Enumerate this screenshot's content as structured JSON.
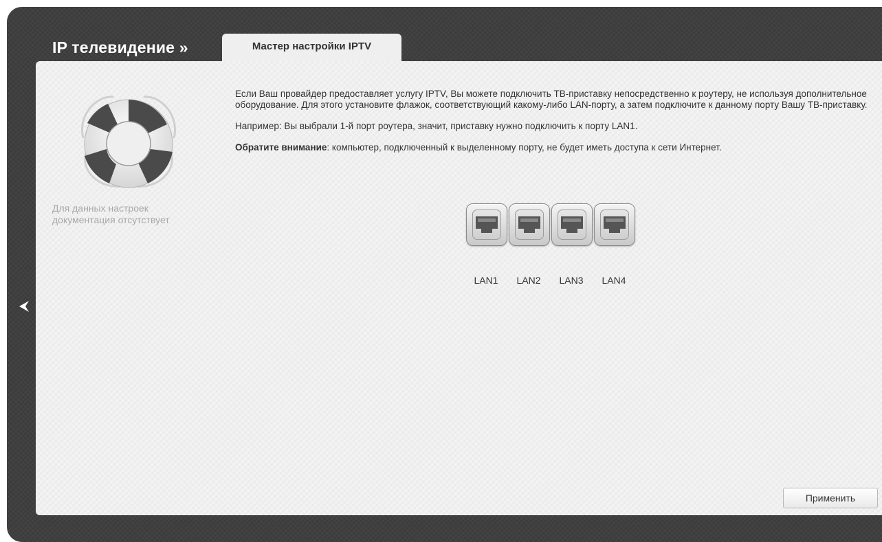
{
  "header": {
    "section_title": "IP телевидение »",
    "tab_label": "Мастер настройки IPTV"
  },
  "sidebar": {
    "help_icon": "lifebuoy-icon",
    "help_text": "Для данных настроек документация отсутствует"
  },
  "nav": {
    "back_icon": "chevron-left-icon"
  },
  "main": {
    "intro": "Если Ваш провайдер предоставляет услугу IPTV, Вы можете подключить ТВ-приставку непосредственно к роутеру, не используя дополнительное оборудование. Для этого установите флажок, соответствующий какому-либо LAN-порту, а затем подключите к данному порту Вашу ТВ-приставку.",
    "example": "Например: Вы выбрали 1-й порт роутера, значит, приставку нужно подключить к порту LAN1.",
    "note_label": "Обратите внимание",
    "note_text": ": компьютер, подключенный к выделенному порту, не будет иметь доступа к сети Интернет.",
    "ports": [
      {
        "label": "LAN1",
        "icon": "ethernet-port-icon"
      },
      {
        "label": "LAN2",
        "icon": "ethernet-port-icon"
      },
      {
        "label": "LAN3",
        "icon": "ethernet-port-icon"
      },
      {
        "label": "LAN4",
        "icon": "ethernet-port-icon"
      }
    ]
  },
  "footer": {
    "apply_label": "Применить"
  },
  "colors": {
    "frame": "#3f3f3f",
    "panel": "#efefef",
    "text": "#333333",
    "muted_text": "#a8a8a8"
  }
}
